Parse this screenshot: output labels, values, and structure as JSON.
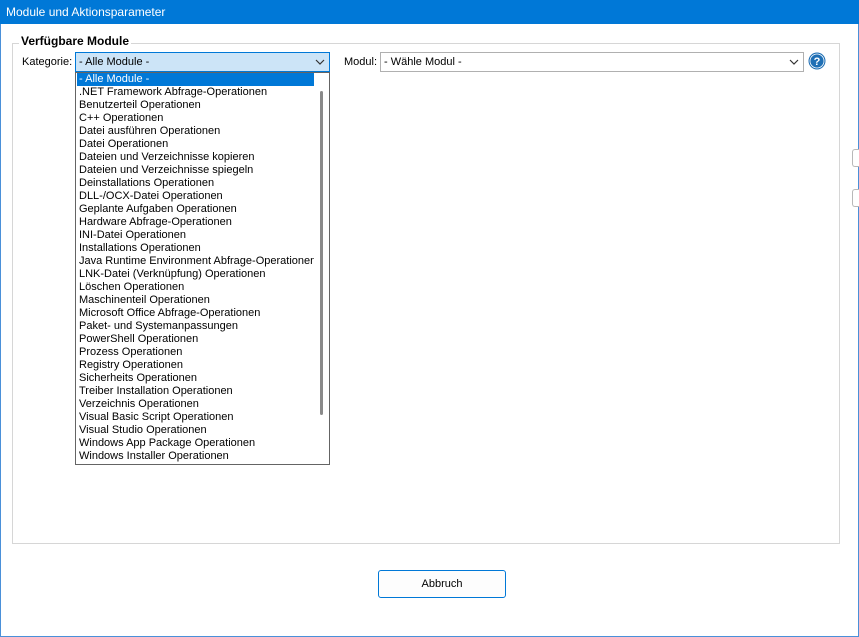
{
  "window": {
    "title": "Module und Aktionsparameter"
  },
  "group": {
    "title": "Verfügbare Module"
  },
  "kategorie": {
    "label": "Kategorie:",
    "selected": "- Alle Module -",
    "options": [
      "- Alle Module -",
      ".NET Framework Abfrage-Operationen",
      "Benutzerteil Operationen",
      "C++ Operationen",
      "Datei ausführen Operationen",
      "Datei Operationen",
      "Dateien und Verzeichnisse kopieren",
      "Dateien und Verzeichnisse spiegeln",
      "Deinstallations Operationen",
      "DLL-/OCX-Datei Operationen",
      "Geplante Aufgaben Operationen",
      "Hardware Abfrage-Operationen",
      "INI-Datei Operationen",
      "Installations Operationen",
      "Java Runtime Environment Abfrage-Operationen",
      "LNK-Datei (Verknüpfung) Operationen",
      "Löschen Operationen",
      "Maschinenteil Operationen",
      "Microsoft Office Abfrage-Operationen",
      "Paket- und Systemanpassungen",
      "PowerShell Operationen",
      "Prozess Operationen",
      "Registry Operationen",
      "Sicherheits Operationen",
      "Treiber Installation Operationen",
      "Verzeichnis Operationen",
      "Visual Basic Script Operationen",
      "Visual Studio Operationen",
      "Windows App Package Operationen",
      "Windows Installer Operationen"
    ]
  },
  "modul": {
    "label": "Modul:",
    "selected": "- Wähle Modul -"
  },
  "buttons": {
    "cancel": "Abbruch"
  },
  "icons": {
    "dropdown_arrow": "chevron-down-icon",
    "help": "help-icon"
  },
  "colors": {
    "titlebar": "#0078d7",
    "selection": "#0078d7",
    "help_icon": "#1f6fb5"
  }
}
